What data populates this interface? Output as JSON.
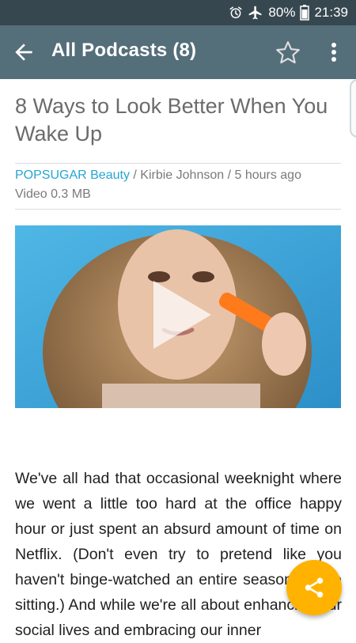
{
  "status_bar": {
    "battery_text": "80%",
    "time": "21:39",
    "icons": [
      "alarm-icon",
      "airplane-icon",
      "battery-icon"
    ]
  },
  "app_bar": {
    "title": "All Podcasts (8)",
    "icons": [
      "back-arrow-icon",
      "star-outline-icon",
      "more-vert-icon"
    ]
  },
  "article": {
    "title": "8 Ways to Look Better When You Wake Up",
    "source": "POPSUGAR Beauty",
    "byline_rest": " / Kirbie Johnson / 5 hours ago",
    "media_info": "Video 0.3 MB",
    "body": "We've all had that occasional weeknight where we went a little too hard at the office happy hour or just spent an absurd amount of time on Netflix. (Don't even try to pretend like you haven't binge-watched an entire season in one sitting.) And while we're all about enhancing our social lives and embracing our inner"
  },
  "fab": {
    "icon": "share-icon"
  },
  "colors": {
    "status_bar": "#37474f",
    "app_bar": "#546e7a",
    "accent_link": "#26a6d1",
    "fab": "#ffb300"
  }
}
